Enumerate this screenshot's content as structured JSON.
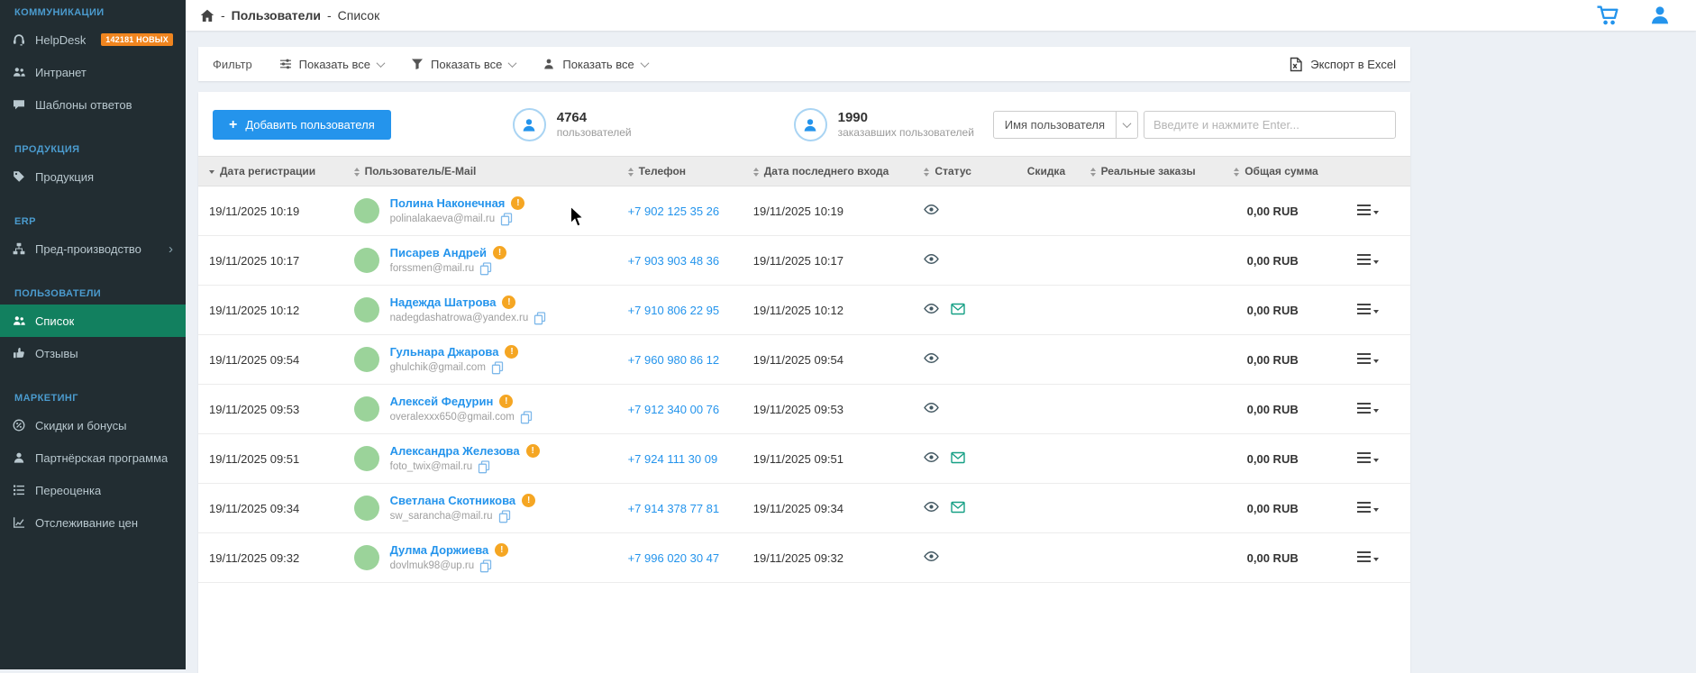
{
  "colors": {
    "accent_blue": "#2494ec",
    "active_nav_green": "#12805f",
    "badge_orange": "#f0851f",
    "avatar_green": "#9bd39a",
    "warning_orange": "#f5a623",
    "mail_icon_teal": "#16a085",
    "sidebar_bg": "#222d32"
  },
  "sidebar": {
    "sections": [
      {
        "header": "КОММУНИКАЦИИ",
        "items": [
          {
            "label": "HelpDesk",
            "badge": "142181 НОВЫХ"
          },
          {
            "label": "Интранет"
          },
          {
            "label": "Шаблоны ответов"
          }
        ]
      },
      {
        "header": "ПРОДУКЦИЯ",
        "items": [
          {
            "label": "Продукция"
          }
        ]
      },
      {
        "header": "ERP",
        "items": [
          {
            "label": "Пред-производство",
            "chevron": "›"
          }
        ]
      },
      {
        "header": "ПОЛЬЗОВАТЕЛИ",
        "items": [
          {
            "label": "Список",
            "active": true
          },
          {
            "label": "Отзывы"
          }
        ]
      },
      {
        "header": "МАРКЕТИНГ",
        "items": [
          {
            "label": "Скидки и бонусы"
          },
          {
            "label": "Партнёрская программа"
          },
          {
            "label": "Переоценка"
          },
          {
            "label": "Отслеживание цен"
          }
        ]
      }
    ]
  },
  "header": {
    "breadcrumb": {
      "separator": "-",
      "section": "Пользователи",
      "page": "Список"
    }
  },
  "filter_bar": {
    "label": "Фильтр",
    "dropdowns": [
      {
        "label": "Показать все"
      },
      {
        "label": "Показать все"
      },
      {
        "label": "Показать все"
      }
    ],
    "export_label": "Экспорт в Excel"
  },
  "toolbar": {
    "add_button": "Добавить пользователя",
    "stats": [
      {
        "value": "4764",
        "label": "пользователей"
      },
      {
        "value": "1990",
        "label": "заказавших пользователей"
      }
    ],
    "search_field": "Имя пользователя",
    "search_placeholder": "Введите и нажмите Enter..."
  },
  "table": {
    "columns": [
      {
        "label": "Дата регистрации",
        "sort": "desc"
      },
      {
        "label": "Пользователь/E-Mail",
        "sort": "both"
      },
      {
        "label": "Телефон",
        "sort": "both"
      },
      {
        "label": "Дата последнего входа",
        "sort": "both"
      },
      {
        "label": "Статус",
        "sort": "both"
      },
      {
        "label": "Скидка",
        "sort": "none"
      },
      {
        "label": "Реальные заказы",
        "sort": "both"
      },
      {
        "label": "Общая сумма",
        "sort": "both"
      }
    ],
    "rows": [
      {
        "reg_date": "19/11/2025 10:19",
        "name": "Полина Наконечная",
        "email": "polinalakaeva@mail.ru",
        "phone": "+7 902 125 35 26",
        "last_login": "19/11/2025 10:19",
        "status_icons": [
          "eye"
        ],
        "discount": "",
        "real_orders": "",
        "total": "0,00 RUB"
      },
      {
        "reg_date": "19/11/2025 10:17",
        "name": "Писарев Андрей",
        "email": "forssmen@mail.ru",
        "phone": "+7 903 903 48 36",
        "last_login": "19/11/2025 10:17",
        "status_icons": [
          "eye"
        ],
        "discount": "",
        "real_orders": "",
        "total": "0,00 RUB"
      },
      {
        "reg_date": "19/11/2025 10:12",
        "name": "Надежда Шатрова",
        "email": "nadegdashatrowa@yandex.ru",
        "phone": "+7 910 806 22 95",
        "last_login": "19/11/2025 10:12",
        "status_icons": [
          "eye",
          "mail"
        ],
        "discount": "",
        "real_orders": "",
        "total": "0,00 RUB"
      },
      {
        "reg_date": "19/11/2025 09:54",
        "name": "Гульнара Джарова",
        "email": "ghulchik@gmail.com",
        "phone": "+7 960 980 86 12",
        "last_login": "19/11/2025 09:54",
        "status_icons": [
          "eye"
        ],
        "discount": "",
        "real_orders": "",
        "total": "0,00 RUB"
      },
      {
        "reg_date": "19/11/2025 09:53",
        "name": "Алексей Федурин",
        "email": "overalexxx650@gmail.com",
        "phone": "+7 912 340 00 76",
        "last_login": "19/11/2025 09:53",
        "status_icons": [
          "eye"
        ],
        "discount": "",
        "real_orders": "",
        "total": "0,00 RUB"
      },
      {
        "reg_date": "19/11/2025 09:51",
        "name": "Александра Железова",
        "email": "foto_twix@mail.ru",
        "phone": "+7 924 111 30 09",
        "last_login": "19/11/2025 09:51",
        "status_icons": [
          "eye",
          "mail"
        ],
        "discount": "",
        "real_orders": "",
        "total": "0,00 RUB"
      },
      {
        "reg_date": "19/11/2025 09:34",
        "name": "Светлана Скотникова",
        "email": "sw_sarancha@mail.ru",
        "phone": "+7 914 378 77 81",
        "last_login": "19/11/2025 09:34",
        "status_icons": [
          "eye",
          "mail"
        ],
        "discount": "",
        "real_orders": "",
        "total": "0,00 RUB"
      },
      {
        "reg_date": "19/11/2025 09:32",
        "name": "Дулма Доржиева",
        "email": "dovlmuk98@up.ru",
        "phone": "+7 996 020 30 47",
        "last_login": "19/11/2025 09:32",
        "status_icons": [
          "eye"
        ],
        "discount": "",
        "real_orders": "",
        "total": "0,00 RUB"
      }
    ]
  }
}
